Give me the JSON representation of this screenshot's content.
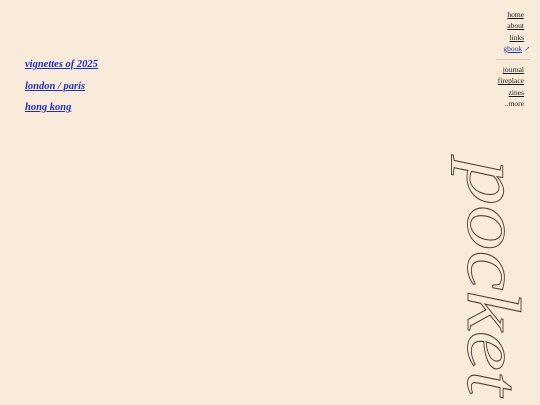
{
  "posts": [
    {
      "label": "vignettes of 2025"
    },
    {
      "label": "london / paris"
    },
    {
      "label": "hong kong"
    }
  ],
  "nav": {
    "primary": [
      "home",
      "about",
      "links"
    ],
    "guestbook": "gbook",
    "guestbook_icon": "external-link-icon",
    "secondary": [
      "journal",
      "fireplace",
      "zines"
    ],
    "more": "..more"
  },
  "decor": {
    "title": "pocket"
  },
  "colors": {
    "background": "#f9ebd9",
    "link": "#1f2fd6",
    "text": "#1a1a1a"
  }
}
